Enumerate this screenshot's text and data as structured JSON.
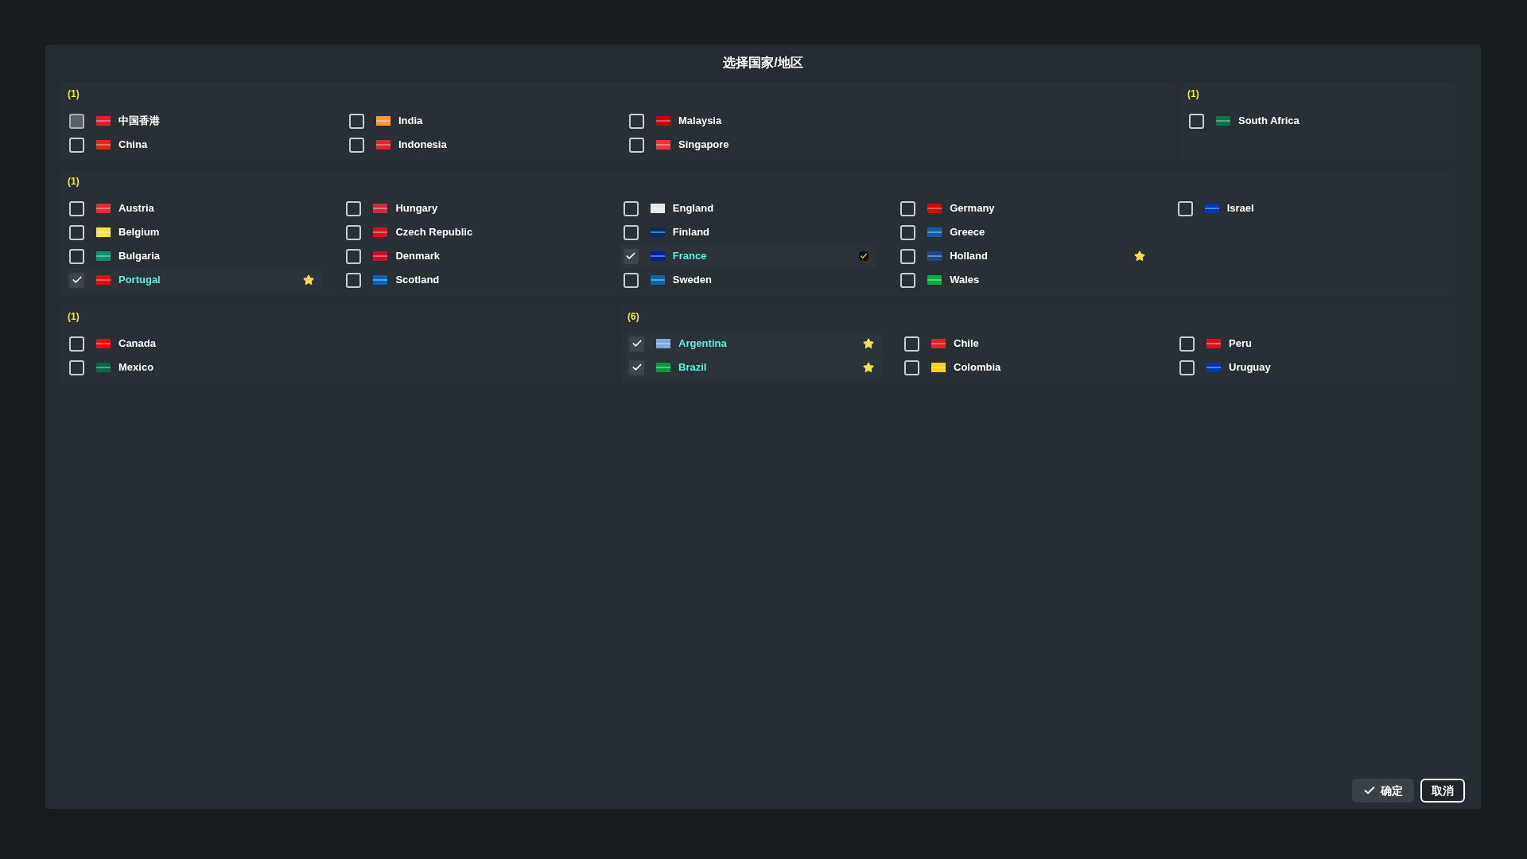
{
  "dialog": {
    "title": "选择国家/地区"
  },
  "groups": [
    {
      "count": "(1)",
      "columns": [
        [
          {
            "name": "中国香港",
            "checked": false,
            "hovered": true,
            "starred": false,
            "ticked": false,
            "color": "#d8232a"
          },
          {
            "name": "China",
            "checked": false,
            "hovered": false,
            "starred": false,
            "ticked": false,
            "color": "#de2910"
          }
        ],
        [
          {
            "name": "India",
            "checked": false,
            "hovered": false,
            "starred": false,
            "ticked": false,
            "color": "#ff9933"
          },
          {
            "name": "Indonesia",
            "checked": false,
            "hovered": false,
            "starred": false,
            "ticked": false,
            "color": "#e0262d"
          }
        ],
        [
          {
            "name": "Malaysia",
            "checked": false,
            "hovered": false,
            "starred": false,
            "ticked": false,
            "color": "#cc0001"
          },
          {
            "name": "Singapore",
            "checked": false,
            "hovered": false,
            "starred": false,
            "ticked": false,
            "color": "#ef3340"
          }
        ]
      ]
    },
    {
      "count": "(1)",
      "columns": [
        [
          {
            "name": "South Africa",
            "checked": false,
            "hovered": false,
            "starred": false,
            "ticked": false,
            "color": "#007a4d"
          }
        ]
      ]
    },
    {
      "count": "(1)",
      "columns": [
        [
          {
            "name": "Austria",
            "checked": false,
            "hovered": false,
            "starred": false,
            "ticked": false,
            "color": "#ed2939"
          },
          {
            "name": "Belgium",
            "checked": false,
            "hovered": false,
            "starred": false,
            "ticked": false,
            "color": "#fae042"
          },
          {
            "name": "Bulgaria",
            "checked": false,
            "hovered": false,
            "starred": false,
            "ticked": false,
            "color": "#00966e"
          },
          {
            "name": "Portugal",
            "checked": true,
            "hovered": false,
            "starred": true,
            "ticked": false,
            "color": "#ff0000"
          }
        ],
        [
          {
            "name": "Hungary",
            "checked": false,
            "hovered": false,
            "starred": false,
            "ticked": false,
            "color": "#cd2a3e"
          },
          {
            "name": "Czech Republic",
            "checked": false,
            "hovered": false,
            "starred": false,
            "ticked": false,
            "color": "#d7141a"
          },
          {
            "name": "Denmark",
            "checked": false,
            "hovered": false,
            "starred": false,
            "ticked": false,
            "color": "#c8102e"
          },
          {
            "name": "Scotland",
            "checked": false,
            "hovered": false,
            "starred": false,
            "ticked": false,
            "color": "#0065bd"
          }
        ],
        [
          {
            "name": "England",
            "checked": false,
            "hovered": false,
            "starred": false,
            "ticked": false,
            "color": "#e8e8e8"
          },
          {
            "name": "Finland",
            "checked": false,
            "hovered": false,
            "starred": false,
            "ticked": false,
            "color": "#002f6c"
          },
          {
            "name": "France",
            "checked": true,
            "hovered": false,
            "starred": false,
            "ticked": true,
            "color": "#002395"
          },
          {
            "name": "Sweden",
            "checked": false,
            "hovered": false,
            "starred": false,
            "ticked": false,
            "color": "#006aa7"
          }
        ],
        [
          {
            "name": "Germany",
            "checked": false,
            "hovered": false,
            "starred": false,
            "ticked": false,
            "color": "#dd0000"
          },
          {
            "name": "Greece",
            "checked": false,
            "hovered": false,
            "starred": false,
            "ticked": false,
            "color": "#0d5eaf"
          },
          {
            "name": "Holland",
            "checked": false,
            "hovered": false,
            "starred": true,
            "ticked": false,
            "color": "#21468b"
          },
          {
            "name": "Wales",
            "checked": false,
            "hovered": false,
            "starred": false,
            "ticked": false,
            "color": "#00b140"
          }
        ],
        [
          {
            "name": "Israel",
            "checked": false,
            "hovered": false,
            "starred": false,
            "ticked": false,
            "color": "#0038b8"
          }
        ]
      ]
    },
    {
      "count": "(1)",
      "columns": [
        [
          {
            "name": "Canada",
            "checked": false,
            "hovered": false,
            "starred": false,
            "ticked": false,
            "color": "#ff0000"
          },
          {
            "name": "Mexico",
            "checked": false,
            "hovered": false,
            "starred": false,
            "ticked": false,
            "color": "#006847"
          }
        ]
      ]
    },
    {
      "count": "(6)",
      "columns": [
        [
          {
            "name": "Argentina",
            "checked": true,
            "hovered": false,
            "starred": true,
            "ticked": false,
            "color": "#74acdf"
          },
          {
            "name": "Brazil",
            "checked": true,
            "hovered": false,
            "starred": true,
            "ticked": false,
            "color": "#009c3b"
          }
        ],
        [
          {
            "name": "Chile",
            "checked": false,
            "hovered": false,
            "starred": false,
            "ticked": false,
            "color": "#d52b1e"
          },
          {
            "name": "Colombia",
            "checked": false,
            "hovered": false,
            "starred": false,
            "ticked": false,
            "color": "#fcd116"
          }
        ],
        [
          {
            "name": "Peru",
            "checked": false,
            "hovered": false,
            "starred": false,
            "ticked": false,
            "color": "#d91023"
          },
          {
            "name": "Uruguay",
            "checked": false,
            "hovered": false,
            "starred": false,
            "ticked": false,
            "color": "#0038a8"
          }
        ]
      ]
    }
  ],
  "buttons": {
    "confirm": "确定",
    "cancel": "取消"
  }
}
